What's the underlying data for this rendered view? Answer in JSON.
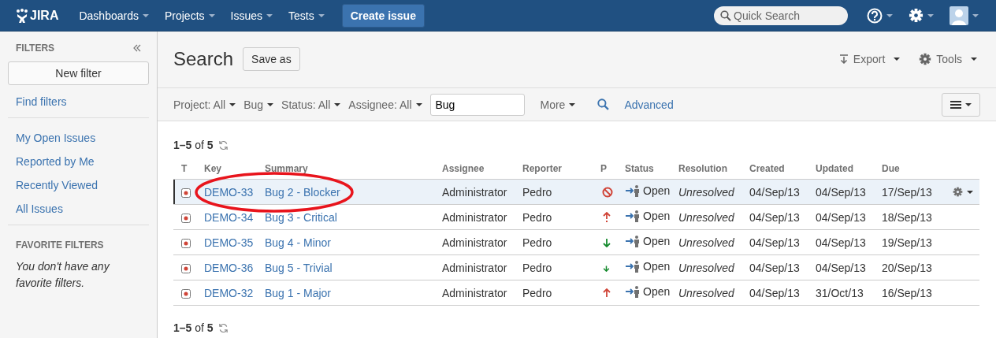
{
  "topbar": {
    "logo": "JIRA",
    "menus": [
      {
        "label": "Dashboards"
      },
      {
        "label": "Projects"
      },
      {
        "label": "Issues"
      },
      {
        "label": "Tests"
      }
    ],
    "create_button": "Create issue",
    "search": {
      "placeholder": "Quick Search"
    }
  },
  "sidebar": {
    "title": "FILTERS",
    "new_filter": "New filter",
    "find_filters": "Find filters",
    "items": [
      {
        "label": "My Open Issues"
      },
      {
        "label": "Reported by Me"
      },
      {
        "label": "Recently Viewed"
      },
      {
        "label": "All Issues"
      }
    ],
    "favorites_title": "FAVORITE FILTERS",
    "favorites_empty": "You don't have any favorite filters."
  },
  "page": {
    "title": "Search",
    "save_as": "Save as",
    "export": "Export",
    "tools": "Tools"
  },
  "filters": {
    "criteria": [
      {
        "label": "Project: All"
      },
      {
        "label": "Bug"
      },
      {
        "label": "Status: All"
      },
      {
        "label": "Assignee: All"
      }
    ],
    "text": "Bug",
    "more": "More",
    "advanced": "Advanced"
  },
  "count_top": "**1–5** of **5**",
  "count_bottom": "**1–5** of **5**",
  "table": {
    "columns": [
      "T",
      "Key",
      "Summary",
      "Assignee",
      "Reporter",
      "P",
      "Status",
      "Resolution",
      "Created",
      "Updated",
      "Due"
    ],
    "rows": [
      {
        "key": "DEMO-33",
        "summary": "Bug 2 - Blocker",
        "assignee": "Administrator",
        "reporter": "Pedro",
        "kind": "blocker",
        "status": "Open",
        "resolution": "Unresolved",
        "created": "04/Sep/13",
        "updated": "04/Sep/13",
        "due": "17/Sep/13",
        "selected": true,
        "circled": true
      },
      {
        "key": "DEMO-34",
        "summary": "Bug 3 - Critical",
        "assignee": "Administrator",
        "reporter": "Pedro",
        "kind": "critical",
        "status": "Open",
        "resolution": "Unresolved",
        "created": "04/Sep/13",
        "updated": "04/Sep/13",
        "due": "18/Sep/13",
        "selected": false,
        "circled": false
      },
      {
        "key": "DEMO-35",
        "summary": "Bug 4 - Minor",
        "assignee": "Administrator",
        "reporter": "Pedro",
        "kind": "minor",
        "status": "Open",
        "resolution": "Unresolved",
        "created": "04/Sep/13",
        "updated": "04/Sep/13",
        "due": "19/Sep/13",
        "selected": false,
        "circled": false
      },
      {
        "key": "DEMO-36",
        "summary": "Bug 5 - Trivial",
        "assignee": "Administrator",
        "reporter": "Pedro",
        "kind": "trivial",
        "status": "Open",
        "resolution": "Unresolved",
        "created": "04/Sep/13",
        "updated": "04/Sep/13",
        "due": "20/Sep/13",
        "selected": false,
        "circled": false
      },
      {
        "key": "DEMO-32",
        "summary": "Bug 1 - Major",
        "assignee": "Administrator",
        "reporter": "Pedro",
        "kind": "major",
        "status": "Open",
        "resolution": "Unresolved",
        "created": "04/Sep/13",
        "updated": "31/Oct/13",
        "due": "16/Sep/13",
        "selected": false,
        "circled": false
      }
    ]
  }
}
